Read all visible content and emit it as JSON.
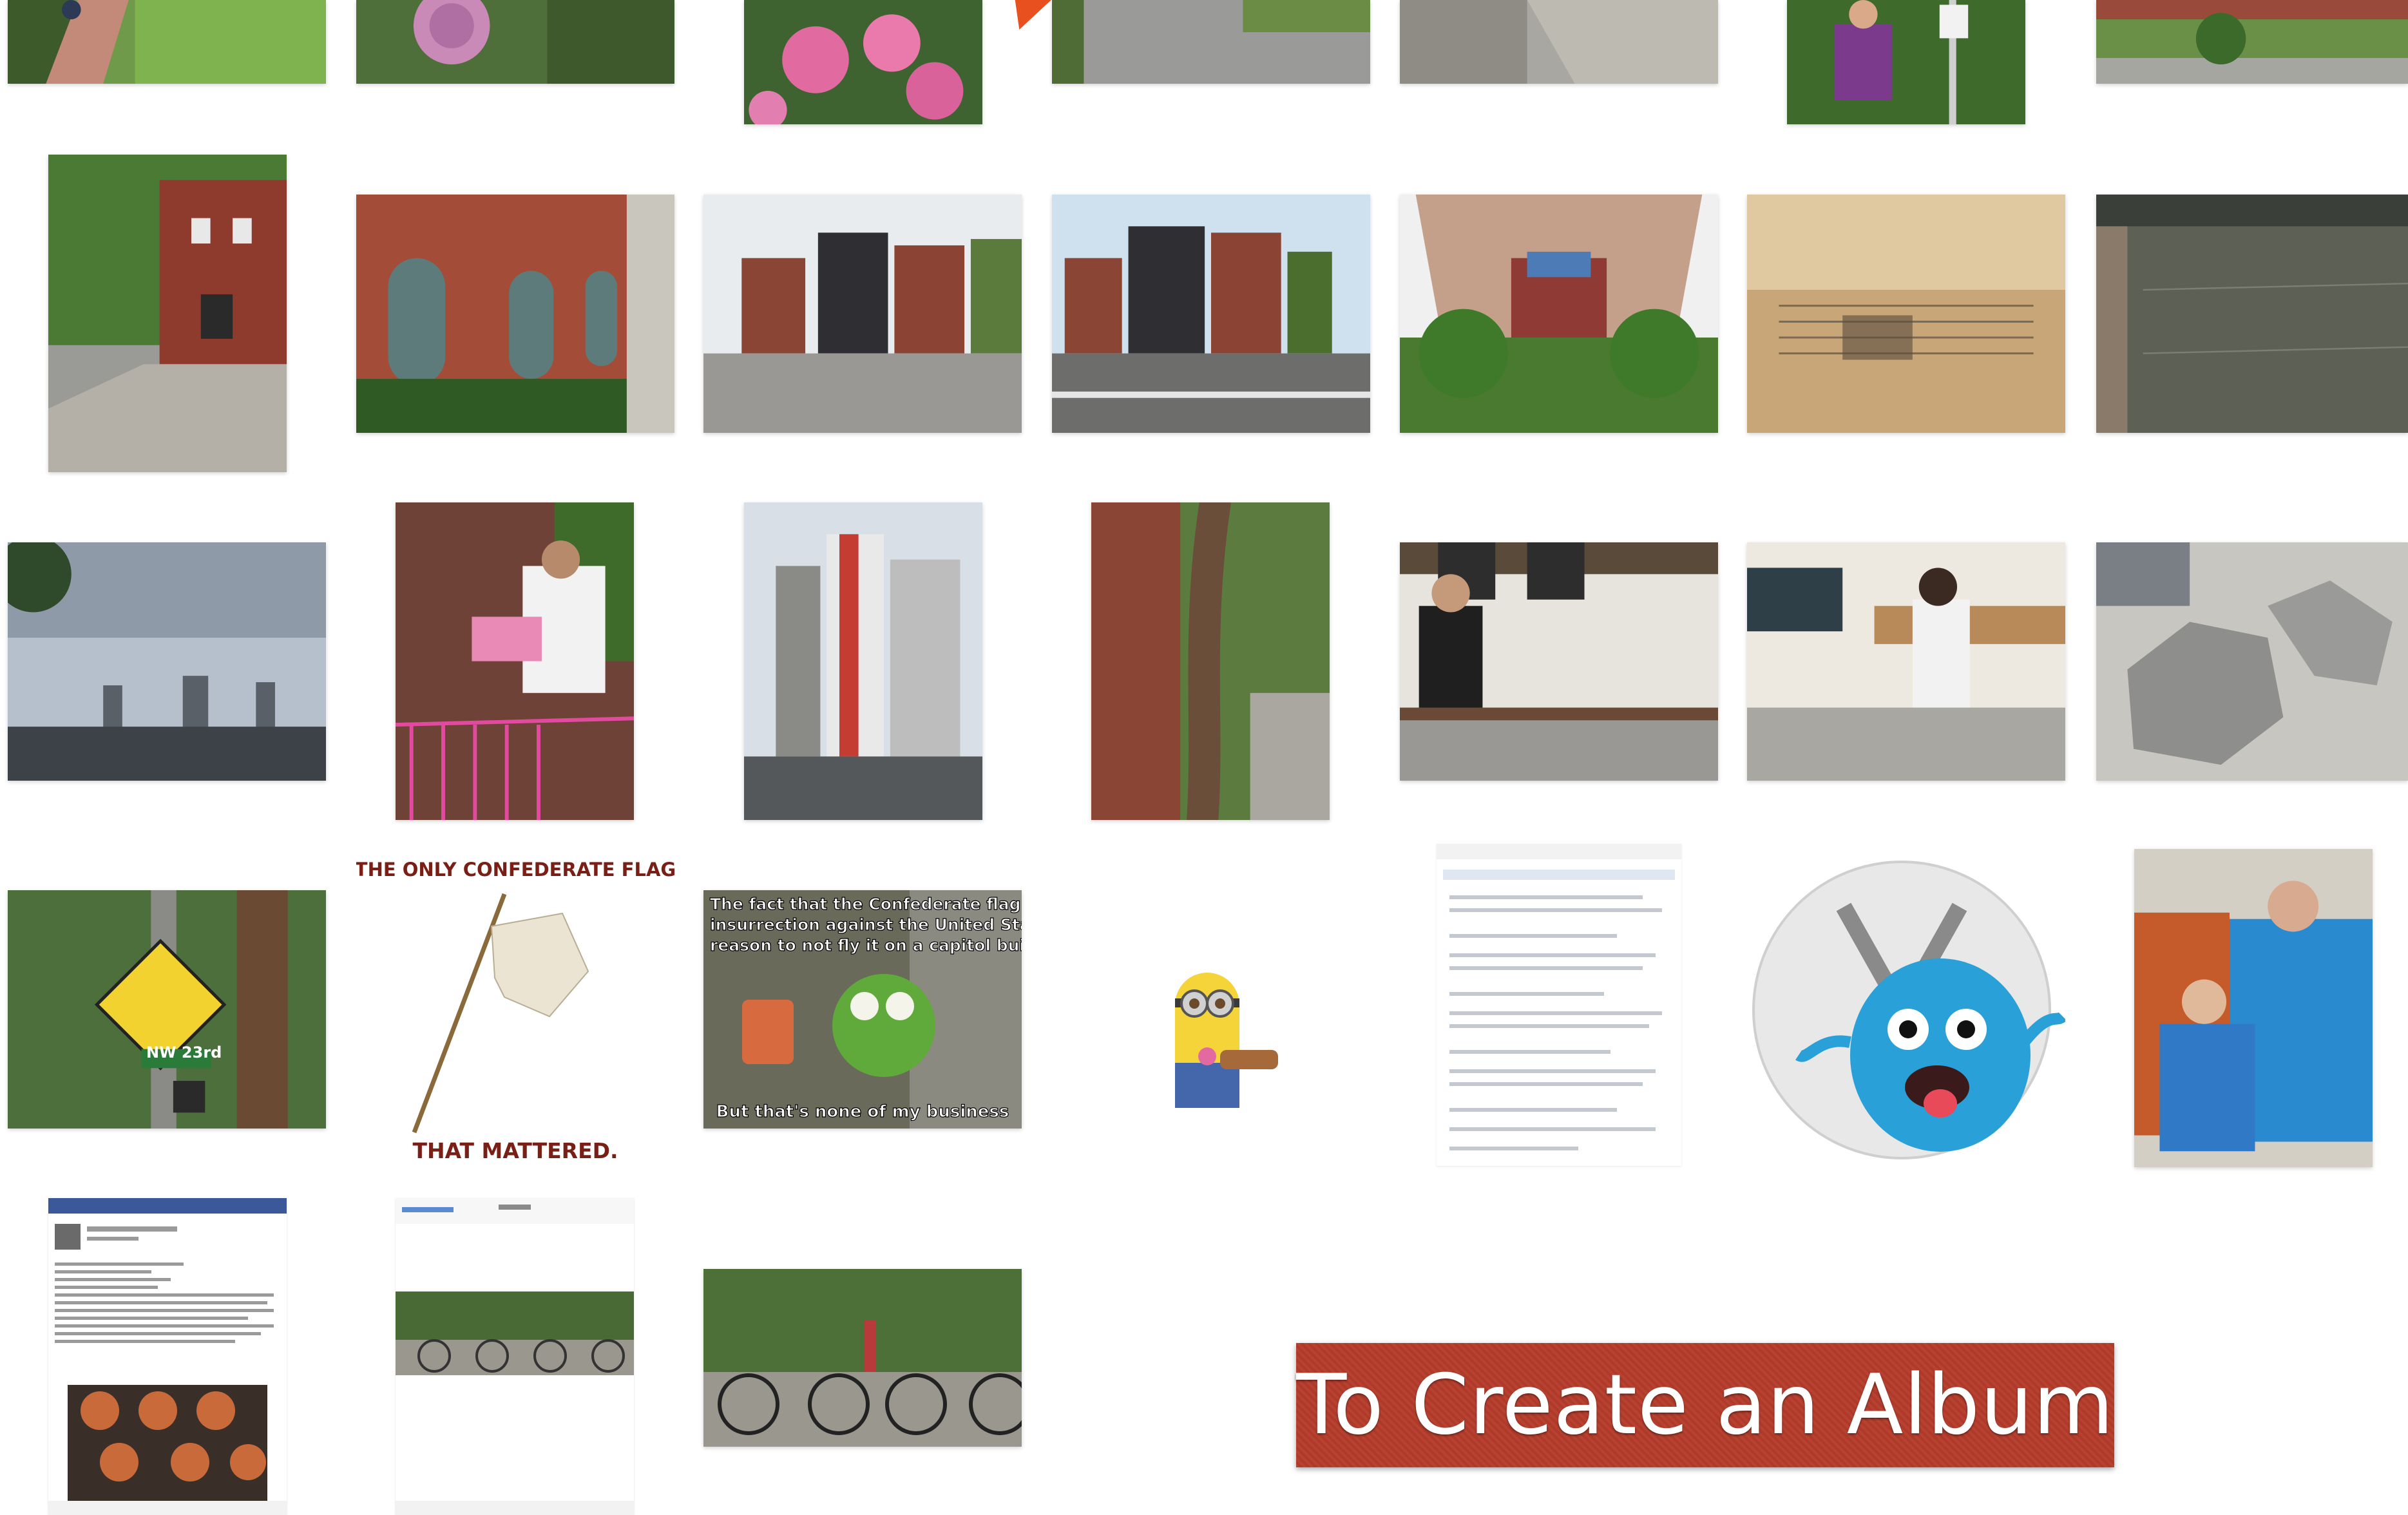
{
  "banner": {
    "title": "To Create an Album"
  },
  "memes": {
    "flag_top": "THE ONLY CONFEDERATE FLAG",
    "flag_bottom": "THAT MATTERED.",
    "kermit_top_1": "The fact that the Confederate flag represents an",
    "kermit_top_2": "insurrection against the United States is plenty of",
    "kermit_top_3": "reason to not fly it on a capitol building.",
    "kermit_bottom": "But that's none of my business"
  },
  "street_sign": {
    "text": "NW 23rd"
  },
  "colors": {
    "banner": "#b53c2b",
    "marker": "#e8501f",
    "background": "#ffffff"
  },
  "thumbnails": [
    {
      "row": 0,
      "subject": "garden-path"
    },
    {
      "row": 0,
      "subject": "pink-rose"
    },
    {
      "row": 0,
      "subject": "pink-flowers"
    },
    {
      "row": 0,
      "subject": "sidewalk"
    },
    {
      "row": 0,
      "subject": "curb"
    },
    {
      "row": 0,
      "subject": "man-with-sign"
    },
    {
      "row": 0,
      "subject": "garden"
    },
    {
      "row": 1,
      "subject": "brick-house"
    },
    {
      "row": 1,
      "subject": "brick-building-arched"
    },
    {
      "row": 1,
      "subject": "modern-brick-building"
    },
    {
      "row": 1,
      "subject": "modern-brick-building-2"
    },
    {
      "row": 1,
      "subject": "portland-building"
    },
    {
      "row": 1,
      "subject": "engraved-stone"
    },
    {
      "row": 1,
      "subject": "river-water"
    },
    {
      "row": 2,
      "subject": "city-skyline"
    },
    {
      "row": 2,
      "subject": "man-with-pink-boxes"
    },
    {
      "row": 2,
      "subject": "tall-building"
    },
    {
      "row": 2,
      "subject": "tree-by-wall"
    },
    {
      "row": 2,
      "subject": "bakery-counter"
    },
    {
      "row": 2,
      "subject": "bakery-counter-2"
    },
    {
      "row": 2,
      "subject": "metal-animal-statues"
    },
    {
      "row": 3,
      "subject": "street-sign"
    },
    {
      "row": 3,
      "subject": "white-flag-meme"
    },
    {
      "row": 3,
      "subject": "kermit-meme"
    },
    {
      "row": 3,
      "subject": "minion"
    },
    {
      "row": 3,
      "subject": "webpage-screenshot"
    },
    {
      "row": 3,
      "subject": "yosemite-monster-icon"
    },
    {
      "row": 3,
      "subject": "children-in-chair"
    },
    {
      "row": 4,
      "subject": "facebook-recipe-screenshot"
    },
    {
      "row": 4,
      "subject": "photo-screenshot-bikes"
    },
    {
      "row": 4,
      "subject": "bicycles-in-park"
    }
  ]
}
